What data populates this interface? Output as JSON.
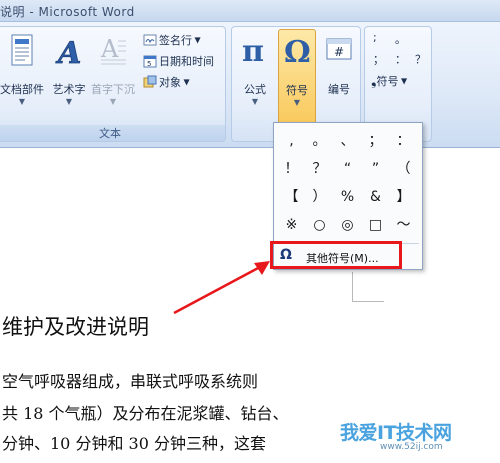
{
  "window": {
    "title": "说明 - Microsoft Word"
  },
  "ribbon": {
    "group_text": {
      "caption": "文本",
      "doc_parts": "文档部件",
      "wordart": "艺术字",
      "dropcap": "首字下沉",
      "signature": "签名行",
      "datetime": "日期和时间",
      "object": "对象"
    },
    "group_symbols": {
      "formula": "公式",
      "symbol": "符号",
      "number": "编号"
    },
    "special": {
      "symbol_label": "符号",
      "chars": [
        ";",
        "。",
        "；",
        "：",
        "？"
      ]
    }
  },
  "symbol_dropdown": {
    "symbols": [
      ",",
      "。",
      "、",
      "；",
      "：",
      "！",
      "？",
      "“",
      "”",
      "（",
      "【",
      "）",
      "%",
      "&",
      "】",
      "※",
      "○",
      "◎",
      "□",
      "～"
    ],
    "more_symbols": "其他符号(M)..."
  },
  "document": {
    "heading": "维护及改进说明",
    "lines": [
      "空气呼吸器组成，串联式呼吸系统则",
      "共 18 个气瓶）及分布在泥浆罐、钻台、",
      "分钟、10 分钟和 30 分钟三种，这套"
    ]
  },
  "watermark": {
    "main": "我爱IT技术网",
    "sub": "www.52ij.com"
  },
  "colors": {
    "accent_red": "#e8171b",
    "ribbon_blue": "#dde8f7"
  }
}
